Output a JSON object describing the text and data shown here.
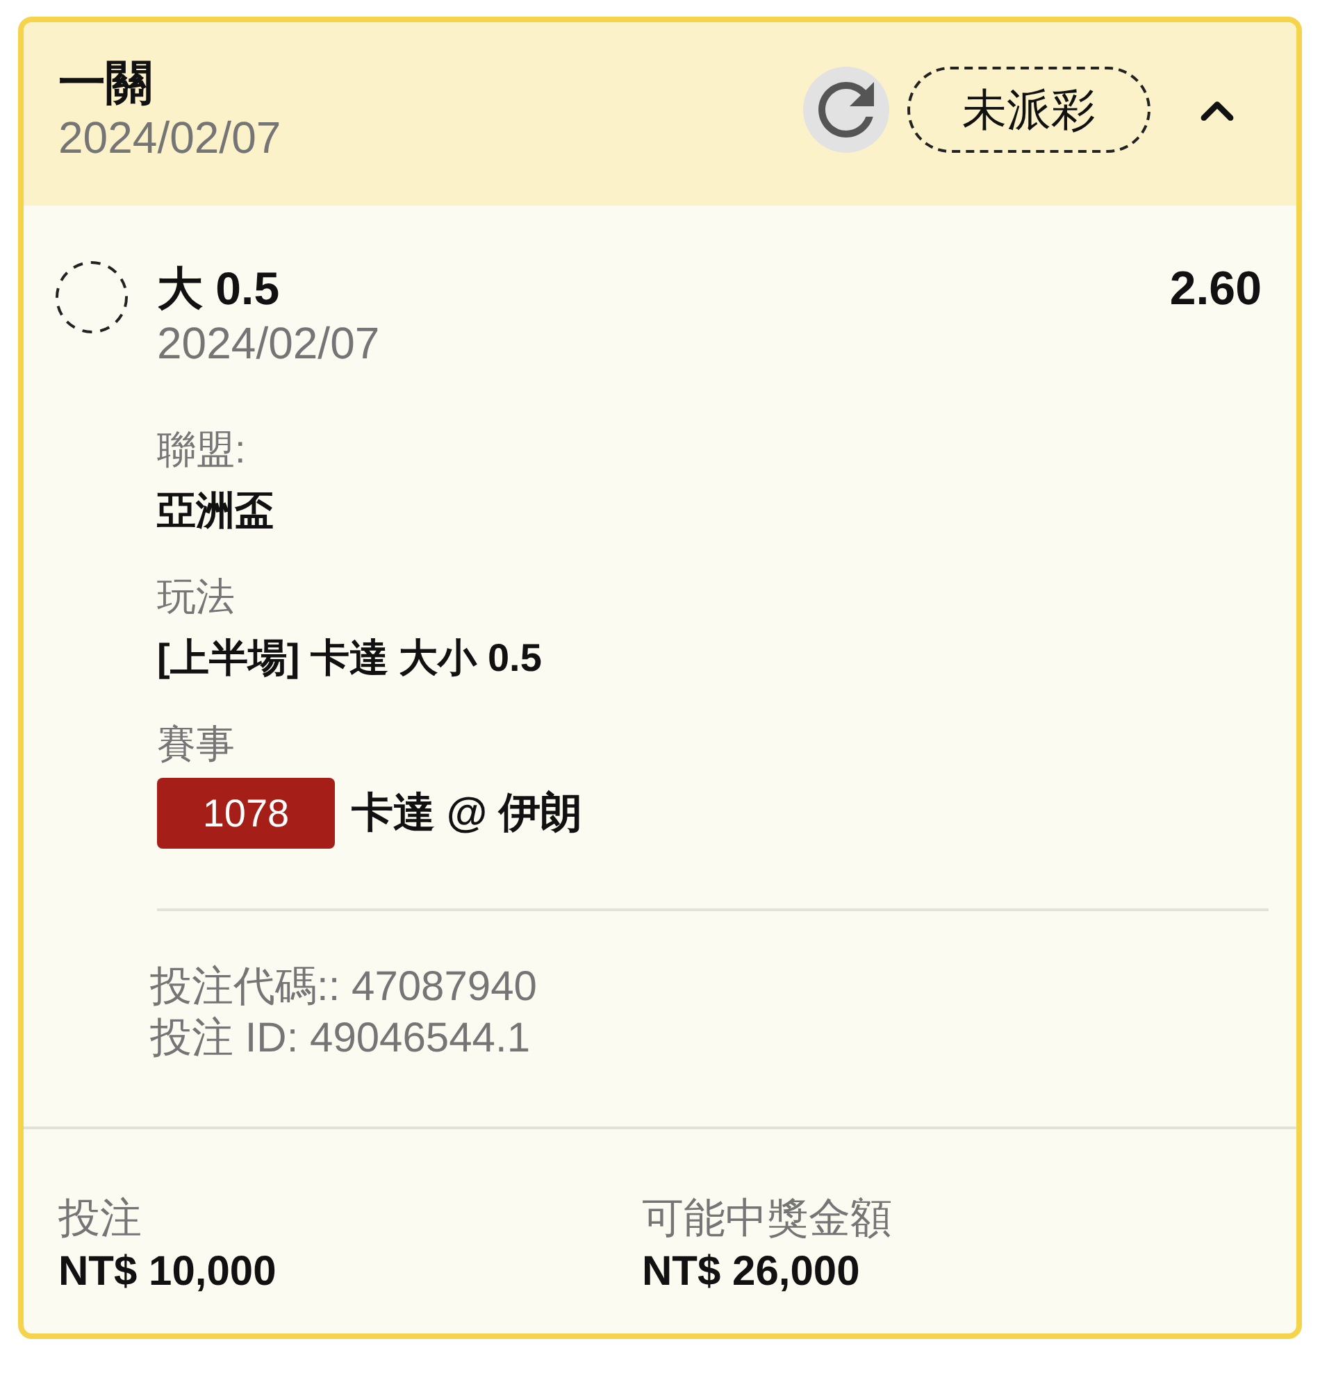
{
  "header": {
    "title": "一關",
    "date": "2024/02/07",
    "status": "未派彩",
    "expanded": true
  },
  "selection": {
    "name": "大 0.5",
    "odds": "2.60",
    "date": "2024/02/07"
  },
  "details": [
    {
      "kind": "text",
      "label": "聯盟:",
      "value": "亞洲盃"
    },
    {
      "kind": "text",
      "label": "玩法",
      "value": "[上半場] 卡達 大小 0.5"
    },
    {
      "kind": "event",
      "label": "賽事",
      "badge": "1078",
      "value": "卡達 @ 伊朗"
    }
  ],
  "references": [
    "投注代碼:: 47087940",
    "投注 ID: 49046544.1"
  ],
  "footer": [
    {
      "label": "投注",
      "value": "NT$ 10,000"
    },
    {
      "label": "可能中獎金額",
      "value": "NT$ 26,000"
    }
  ]
}
